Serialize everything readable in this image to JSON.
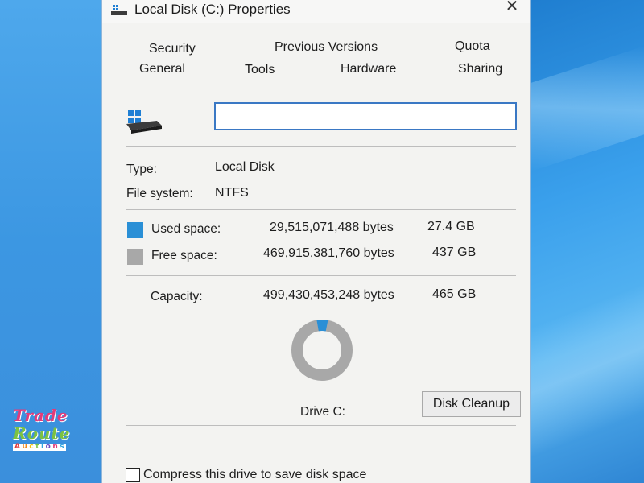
{
  "window": {
    "title": "Local Disk (C:) Properties",
    "close_glyph": "✕"
  },
  "tabs_row1": [
    "Security",
    "Previous Versions",
    "Quota"
  ],
  "tabs_row2": [
    "General",
    "Tools",
    "Hardware",
    "Sharing"
  ],
  "drive_name_value": "",
  "info": {
    "type_label": "Type:",
    "type_value": "Local Disk",
    "fs_label": "File system:",
    "fs_value": "NTFS"
  },
  "space": {
    "used_label": "Used space:",
    "used_bytes": "29,515,071,488 bytes",
    "used_human": "27.4 GB",
    "free_label": "Free space:",
    "free_bytes": "469,915,381,760 bytes",
    "free_human": "437 GB",
    "capacity_label": "Capacity:",
    "capacity_bytes": "499,430,453,248 bytes",
    "capacity_human": "465 GB",
    "used_fraction": 0.059
  },
  "colors": {
    "used": "#2a8fd6",
    "free": "#a8a8a8"
  },
  "drive_label": "Drive C:",
  "disk_cleanup_label": "Disk Cleanup",
  "compress_label": "Compress this drive to save disk space",
  "watermark": {
    "line1": "Trade",
    "line2": "Route",
    "line3": "Auctions"
  },
  "icons": [
    "drive-icon",
    "close-icon",
    "checkbox-icon"
  ]
}
